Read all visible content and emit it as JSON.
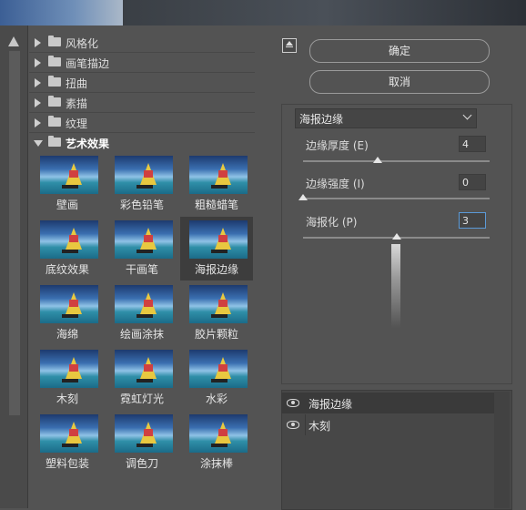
{
  "categories": [
    {
      "label": "风格化",
      "expanded": false
    },
    {
      "label": "画笔描边",
      "expanded": false
    },
    {
      "label": "扭曲",
      "expanded": false
    },
    {
      "label": "素描",
      "expanded": false
    },
    {
      "label": "纹理",
      "expanded": false
    },
    {
      "label": "艺术效果",
      "expanded": true
    }
  ],
  "filters": [
    {
      "label": "壁画",
      "icon": "fresco-thumbnail",
      "selected": false
    },
    {
      "label": "彩色铅笔",
      "icon": "colored-pencil-thumbnail",
      "selected": false
    },
    {
      "label": "粗糙蜡笔",
      "icon": "rough-pastels-thumbnail",
      "selected": false
    },
    {
      "label": "底纹效果",
      "icon": "underpainting-thumbnail",
      "selected": false
    },
    {
      "label": "干画笔",
      "icon": "dry-brush-thumbnail",
      "selected": false
    },
    {
      "label": "海报边缘",
      "icon": "poster-edges-thumbnail",
      "selected": true
    },
    {
      "label": "海绵",
      "icon": "sponge-thumbnail",
      "selected": false
    },
    {
      "label": "绘画涂抹",
      "icon": "paint-daubs-thumbnail",
      "selected": false
    },
    {
      "label": "胶片颗粒",
      "icon": "film-grain-thumbnail",
      "selected": false
    },
    {
      "label": "木刻",
      "icon": "cutout-thumbnail",
      "selected": false
    },
    {
      "label": "霓虹灯光",
      "icon": "neon-glow-thumbnail",
      "selected": false
    },
    {
      "label": "水彩",
      "icon": "watercolor-thumbnail",
      "selected": false
    },
    {
      "label": "塑料包装",
      "icon": "plastic-wrap-thumbnail",
      "selected": false
    },
    {
      "label": "调色刀",
      "icon": "palette-knife-thumbnail",
      "selected": false
    },
    {
      "label": "涂抹棒",
      "icon": "smudge-stick-thumbnail",
      "selected": false
    }
  ],
  "buttons": {
    "ok": "确定",
    "cancel": "取消"
  },
  "current_filter": "海报边缘",
  "params": [
    {
      "label": "边缘厚度 (E)",
      "value": "4",
      "level": 0.4
    },
    {
      "label": "边缘强度 (I)",
      "value": "0",
      "level": 0.0
    },
    {
      "label": "海报化 (P)",
      "value": "3",
      "level": 0.5
    }
  ],
  "layers": [
    {
      "name": "海报边缘",
      "active": true
    },
    {
      "name": "木刻",
      "active": false
    }
  ],
  "colors": {
    "panel": "#535353",
    "selected_bg": "#3d3d3d",
    "focus_border": "#5b9ad8",
    "button_border": "#9a9a9a"
  }
}
